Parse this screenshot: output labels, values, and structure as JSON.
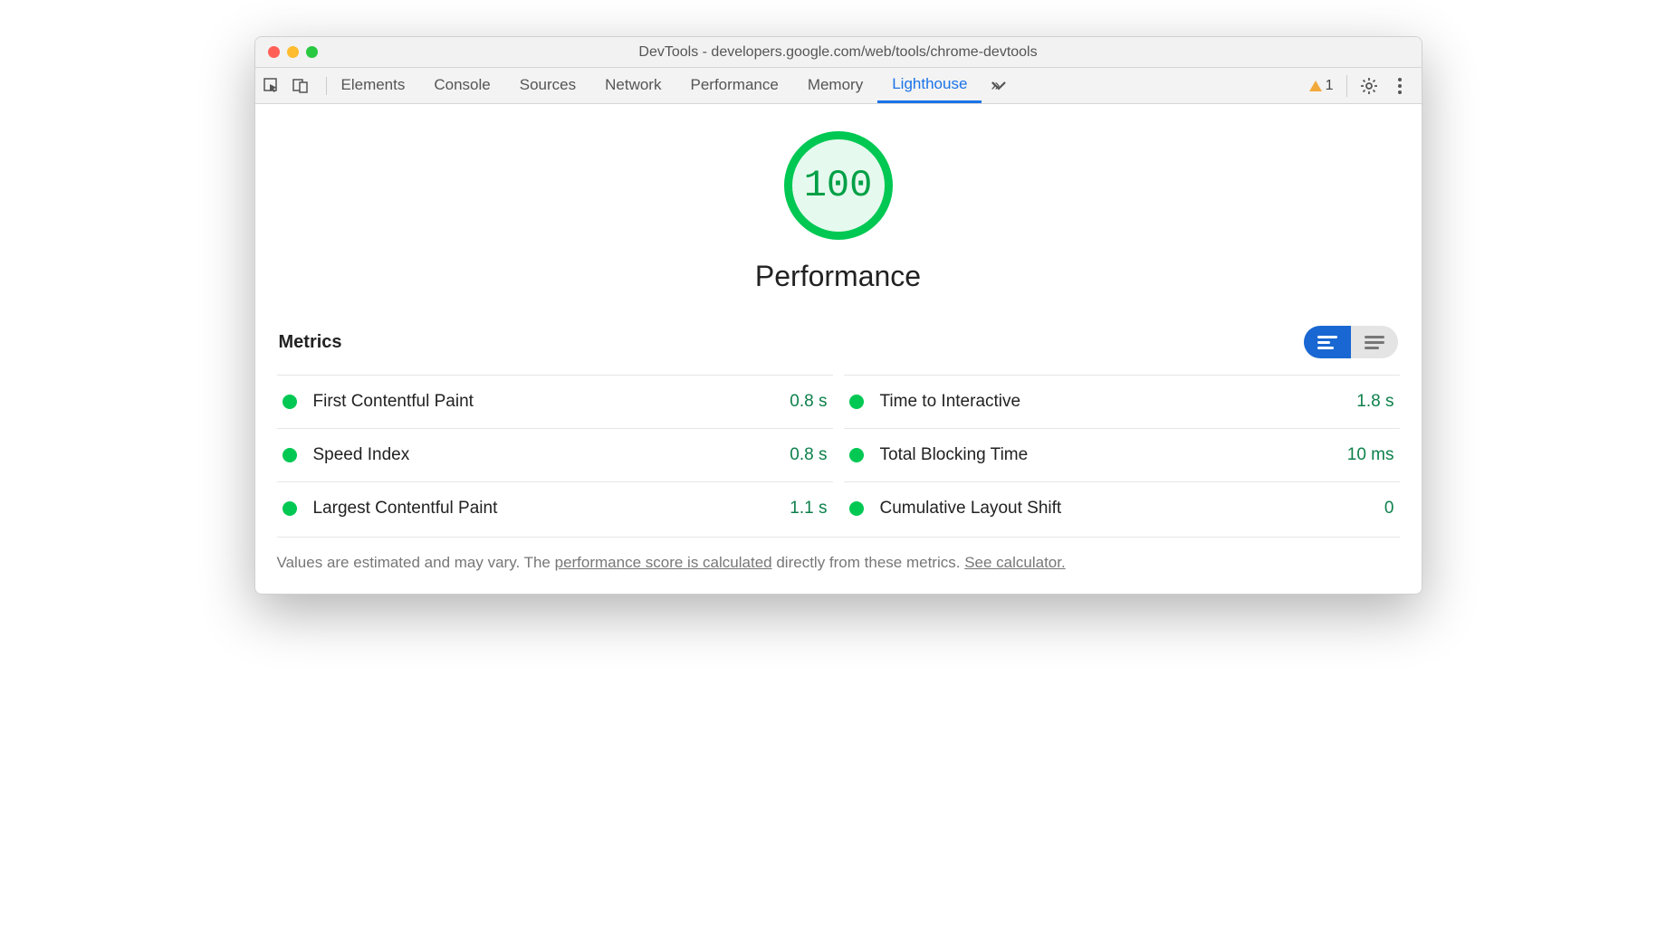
{
  "window": {
    "title": "DevTools - developers.google.com/web/tools/chrome-devtools"
  },
  "toolbar": {
    "tabs": [
      {
        "label": "Elements",
        "active": false
      },
      {
        "label": "Console",
        "active": false
      },
      {
        "label": "Sources",
        "active": false
      },
      {
        "label": "Network",
        "active": false
      },
      {
        "label": "Performance",
        "active": false
      },
      {
        "label": "Memory",
        "active": false
      },
      {
        "label": "Lighthouse",
        "active": true
      }
    ],
    "warning_count": "1"
  },
  "lighthouse": {
    "score": "100",
    "category": "Performance",
    "metrics_heading": "Metrics",
    "metrics_left": [
      {
        "name": "First Contentful Paint",
        "value": "0.8 s"
      },
      {
        "name": "Speed Index",
        "value": "0.8 s"
      },
      {
        "name": "Largest Contentful Paint",
        "value": "1.1 s"
      }
    ],
    "metrics_right": [
      {
        "name": "Time to Interactive",
        "value": "1.8 s"
      },
      {
        "name": "Total Blocking Time",
        "value": "10 ms"
      },
      {
        "name": "Cumulative Layout Shift",
        "value": "0"
      }
    ],
    "footer_prefix": "Values are estimated and may vary. The ",
    "footer_link1": "performance score is calculated",
    "footer_mid": " directly from these metrics. ",
    "footer_link2": "See calculator."
  },
  "colors": {
    "score_green": "#00c853",
    "value_green": "#0d804b",
    "tab_active": "#1a73e8"
  }
}
